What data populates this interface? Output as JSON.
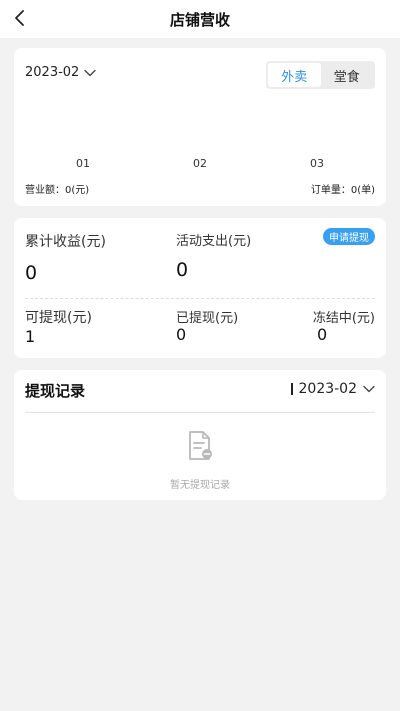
{
  "header": {
    "title": "店铺营收",
    "back_icon": "chevron-left-icon"
  },
  "chart_card": {
    "month": "2023-02",
    "tabs": [
      {
        "label": "外卖",
        "active": true
      },
      {
        "label": "堂食",
        "active": false
      }
    ],
    "x_ticks": [
      "01",
      "02",
      "03"
    ],
    "revenue_label": "营业额：0(元)",
    "orders_label": "订单量：0(单)",
    "accent_color": "#2a8ef0"
  },
  "earnings": {
    "total_label": "累计收益(元)",
    "total_value": "0",
    "activity_label": "活动支出(元)",
    "activity_value": "0",
    "apply_label": "申请提现",
    "withdrawable_label": "可提现(元)",
    "withdrawable_value": "1",
    "withdrawn_label": "已提现(元)",
    "withdrawn_value": "0",
    "frozen_label": "冻结中(元)",
    "frozen_value": "0"
  },
  "records": {
    "title": "提现记录",
    "month": "2023-02",
    "empty_text": "暂无提现记录",
    "empty_icon": "document-icon"
  }
}
